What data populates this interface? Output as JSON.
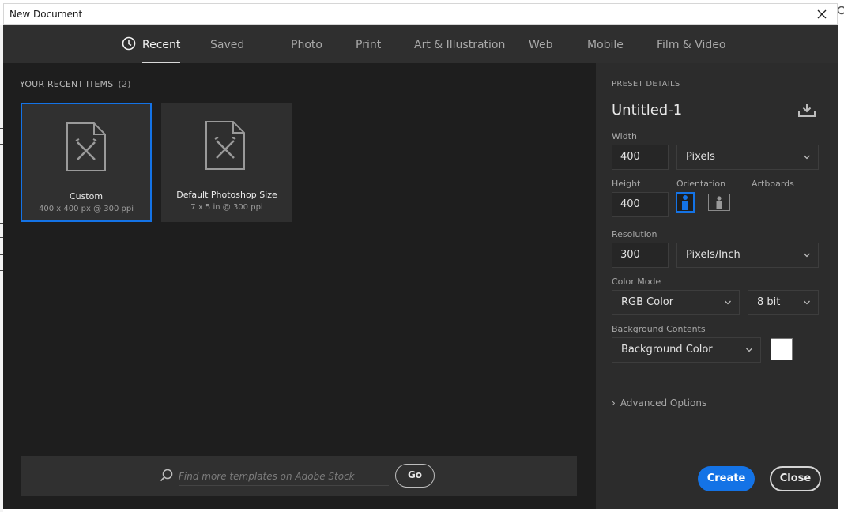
{
  "window": {
    "title": "New Document"
  },
  "tabs": [
    {
      "label": "Recent",
      "active": true,
      "icon": "clock-icon"
    },
    {
      "label": "Saved"
    },
    {
      "label": "Photo"
    },
    {
      "label": "Print"
    },
    {
      "label": "Art & Illustration"
    },
    {
      "label": "Web"
    },
    {
      "label": "Mobile"
    },
    {
      "label": "Film & Video"
    }
  ],
  "recent": {
    "heading": "YOUR RECENT ITEMS",
    "count": "(2)",
    "items": [
      {
        "name": "Custom",
        "detail": "400 x 400 px @ 300 ppi",
        "selected": true
      },
      {
        "name": "Default Photoshop Size",
        "detail": "7 x 5 in @ 300 ppi",
        "selected": false
      }
    ]
  },
  "search": {
    "placeholder": "Find more templates on Adobe Stock",
    "go_label": "Go"
  },
  "preset": {
    "section_label": "PRESET DETAILS",
    "name": "Untitled-1",
    "width_label": "Width",
    "width_value": "400",
    "width_unit": "Pixels",
    "height_label": "Height",
    "height_value": "400",
    "orientation_label": "Orientation",
    "artboards_label": "Artboards",
    "resolution_label": "Resolution",
    "resolution_value": "300",
    "resolution_unit": "Pixels/Inch",
    "color_mode_label": "Color Mode",
    "color_mode": "RGB Color",
    "bit_depth": "8 bit",
    "background_label": "Background Contents",
    "background": "Background Color",
    "background_swatch": "#ffffff",
    "advanced_label": "Advanced Options"
  },
  "actions": {
    "create": "Create",
    "close": "Close"
  },
  "colors": {
    "accent": "#1473e6",
    "panel": "#2c2c2c",
    "canvas": "#1e1e1e"
  }
}
